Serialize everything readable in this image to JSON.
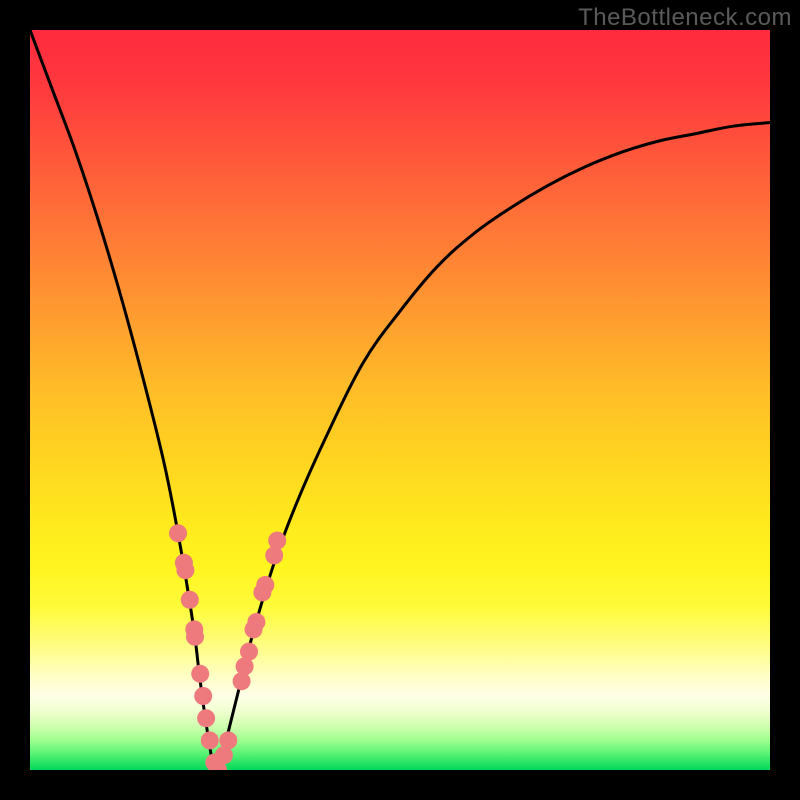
{
  "watermark": "TheBottleneck.com",
  "colors": {
    "frame": "#000000",
    "curve": "#000000",
    "marker": "#ef7a7e",
    "gradient_top": "#ff2a3e",
    "gradient_bottom": "#00d858"
  },
  "chart_data": {
    "type": "line",
    "title": "",
    "xlabel": "",
    "ylabel": "",
    "xlim": [
      0,
      100
    ],
    "ylim": [
      0,
      100
    ],
    "note": "No axis tick labels or numeric values are rendered in the image; x and y values below are estimated from pixel positions on a 0–100 scale for each axis. The curve is an asymmetric V with its minimum near x≈25 reaching y≈0 (green band). Left branch is very steep, right branch is shallower and tapers toward the upper-right.",
    "series": [
      {
        "name": "bottleneck-curve",
        "x": [
          0,
          3,
          6,
          9,
          12,
          15,
          18,
          20,
          22,
          23,
          24,
          25,
          26,
          27,
          28,
          30,
          33,
          36,
          40,
          45,
          50,
          55,
          60,
          65,
          70,
          75,
          80,
          85,
          90,
          95,
          100
        ],
        "y": [
          100,
          92,
          84,
          75,
          65,
          54,
          42,
          32,
          20,
          12,
          5,
          0,
          2,
          6,
          10,
          18,
          28,
          36,
          45,
          55,
          62,
          68,
          72.5,
          76,
          79,
          81.5,
          83.5,
          85,
          86,
          87,
          87.5
        ]
      }
    ],
    "markers": {
      "name": "highlighted-points",
      "note": "Pink circular markers clustered on both branches near the bottom of the V (in the pale-yellow/white band just above the green floor).",
      "x": [
        20.0,
        20.8,
        21.0,
        21.6,
        22.2,
        22.3,
        23.0,
        23.4,
        23.8,
        24.3,
        24.9,
        25.4,
        26.2,
        26.8,
        28.6,
        29.0,
        29.6,
        30.2,
        30.6,
        31.4,
        31.8,
        33.0,
        33.4
      ],
      "y": [
        32,
        28,
        27,
        23,
        19,
        18,
        13,
        10,
        7,
        4,
        1,
        0,
        2,
        4,
        12,
        14,
        16,
        19,
        20,
        24,
        25,
        29,
        31
      ]
    }
  }
}
